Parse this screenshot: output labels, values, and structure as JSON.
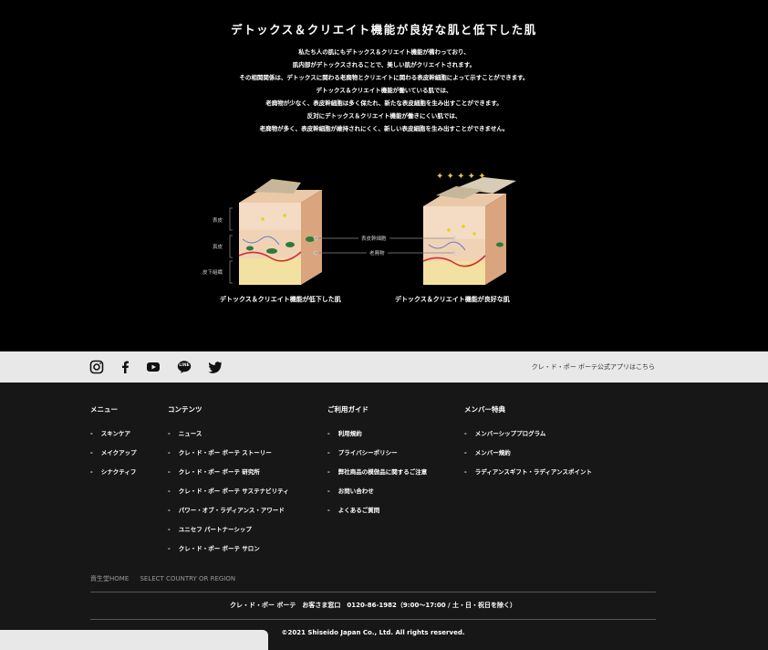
{
  "hero": {
    "title": "デトックス＆クリエイト機能が良好な肌と低下した肌",
    "lines": [
      "私たち人の肌にもデトックス＆クリエイト機能が備わっており、",
      "肌内部がデトックスされることで、美しい肌がクリエイトされます。",
      "その相関関係は、デトックスに関わる老廃物とクリエイトに関わる表皮幹細胞によって示すことができます。",
      "デトックス＆クリエイト機能が働いている肌では、",
      "老廃物が少なく、表皮幹細胞は多く保たれ、新たな表皮細胞を生み出すことができます。",
      "反対にデトックス＆クリエイト機能が働きにくい肌では、",
      "老廃物が多く、表皮幹細胞が維持されにくく、新しい表皮細胞を生み出すことができません。"
    ],
    "layer_labels": [
      "表皮",
      "真皮",
      "皮下組織"
    ],
    "marker_labels": [
      "表皮幹細胞",
      "老廃物"
    ],
    "caption_left": "デトックス＆クリエイト機能が低下した肌",
    "caption_right": "デトックス＆クリエイト機能が良好な肌"
  },
  "social": {
    "icons": [
      "instagram-icon",
      "facebook-icon",
      "youtube-icon",
      "line-icon",
      "twitter-icon"
    ],
    "line_label": "LINE",
    "app_link": "クレ・ド・ポー ボーテ公式アプリはこちら"
  },
  "footer": {
    "menu": {
      "heading": "メニュー",
      "items": [
        "スキンケア",
        "メイクアップ",
        "シナクティフ"
      ]
    },
    "contents": {
      "heading": "コンテンツ",
      "items": [
        "ニュース",
        "クレ・ド・ポー ボーテ ストーリー",
        "クレ・ド・ポー ボーテ 研究所",
        "クレ・ド・ポー ボーテ サステナビリティ",
        "パワー・オブ・ラディアンス・アワード",
        "ユニセフ パートナーシップ",
        "クレ・ド・ポー ボーテ サロン"
      ]
    },
    "guide": {
      "heading": "ご利用ガイド",
      "items": [
        "利用規約",
        "プライバシーポリシー",
        "弊社商品の模倣品に関するご注意",
        "お問い合わせ",
        "よくあるご質問"
      ]
    },
    "member": {
      "heading": "メンバー特典",
      "items": [
        "メンバーシッププログラム",
        "メンバー規約",
        "ラディアンスギフト・ラディアンスポイント"
      ]
    },
    "home_link": "資生堂HOME",
    "country_link": "SELECT COUNTRY OR REGION",
    "contact": "クレ・ド・ポー ボーテ　お客さま窓口　0120-86-1982（9:00〜17:00 / 土・日・祝日を除く）",
    "copyright": "©2021 Shiseido Japan Co., Ltd. All rights reserved."
  }
}
